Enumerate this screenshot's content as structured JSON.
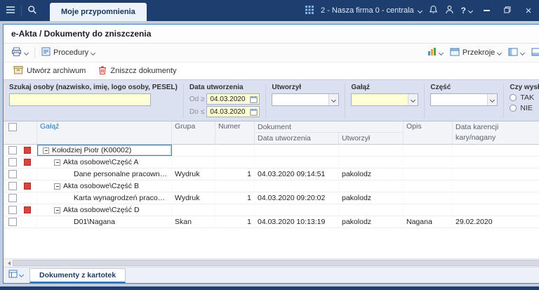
{
  "topbar": {
    "tab_label": "Moje przypomnienia",
    "company_label": "2 - Nasza firma 0 - centrala",
    "help_glyph": "?"
  },
  "window": {
    "title": "e-Akta / Dokumenty do zniszczenia"
  },
  "toolbar": {
    "procedury_label": "Procedury",
    "przekroje_label": "Przekroje"
  },
  "actions": {
    "create_archive_label": "Utwórz archiwum",
    "destroy_documents_label": "Zniszcz dokumenty"
  },
  "filters": {
    "search_label": "Szukaj osoby (nazwisko, imię, logo osoby, PESEL)",
    "search_value": "",
    "date_group_label": "Data utworzenia",
    "from_label": "Od",
    "from_operator": "≥",
    "from_value": "04.03.2020",
    "to_label": "Do",
    "to_operator": "≤",
    "to_value": "04.03.2020",
    "created_by_label": "Utworzył",
    "created_by_value": "",
    "branch_label": "Gałąź",
    "branch_value": "",
    "part_label": "Część",
    "part_value": "",
    "archive_question_label": "Czy wysłane do archiwum",
    "option_yes": "TAK",
    "option_no": "NIE"
  },
  "table": {
    "headers": {
      "galaz": "Gałąź",
      "grupa": "Grupa",
      "numer": "Numer",
      "dokument": "Dokument",
      "data_utworzenia": "Data utworzenia",
      "utworzyl": "Utworzył",
      "opis": "Opis",
      "karencja_line1": "Data karencji",
      "karencja_line2": "kary/nagany"
    },
    "rows": [
      {
        "level": 0,
        "type": "person",
        "expander": true,
        "marker": true,
        "selected": true,
        "galaz": "Kołodziej Piotr (K00002)",
        "grupa": "",
        "numer": "",
        "data_utworzenia": "",
        "utworzyl": "",
        "opis": "",
        "karencja": ""
      },
      {
        "level": 1,
        "type": "group",
        "expander": true,
        "marker": true,
        "selected": false,
        "galaz": "Akta osobowe\\Część A",
        "grupa": "",
        "numer": "",
        "data_utworzenia": "",
        "utworzyl": "",
        "opis": "",
        "karencja": ""
      },
      {
        "level": 2,
        "type": "document",
        "expander": false,
        "marker": false,
        "selected": false,
        "galaz": "Dane personalne pracownika",
        "grupa": "Wydruk",
        "numer": "1",
        "data_utworzenia": "04.03.2020 09:14:51",
        "utworzyl": "pakolodz",
        "opis": "",
        "karencja": ""
      },
      {
        "level": 1,
        "type": "group",
        "expander": true,
        "marker": true,
        "selected": false,
        "galaz": "Akta osobowe\\Część B",
        "grupa": "",
        "numer": "",
        "data_utworzenia": "",
        "utworzyl": "",
        "opis": "",
        "karencja": ""
      },
      {
        "level": 2,
        "type": "document",
        "expander": false,
        "marker": false,
        "selected": false,
        "galaz": "Karta wynagrodzeń pracownika",
        "grupa": "Wydruk",
        "numer": "1",
        "data_utworzenia": "04.03.2020 09:20:02",
        "utworzyl": "pakolodz",
        "opis": "",
        "karencja": ""
      },
      {
        "level": 1,
        "type": "group",
        "expander": true,
        "marker": true,
        "selected": false,
        "galaz": "Akta osobowe\\Część D",
        "grupa": "",
        "numer": "",
        "data_utworzenia": "",
        "utworzyl": "",
        "opis": "",
        "karencja": ""
      },
      {
        "level": 2,
        "type": "document",
        "expander": false,
        "marker": false,
        "selected": false,
        "galaz": "D01\\Nagana",
        "grupa": "Skan",
        "numer": "1",
        "data_utworzenia": "04.03.2020 10:13:19",
        "utworzyl": "pakolodz",
        "opis": "Nagana",
        "karencja": "29.02.2020"
      }
    ]
  },
  "bottombar": {
    "tab_label": "Dokumenty z kartotek"
  },
  "colors": {
    "topbar_bg": "#1d3e6e",
    "accent_blue": "#2e75b6",
    "marker_red": "#d9453c",
    "filter_bg": "#dce1f2",
    "input_yellow": "#ffffd6"
  }
}
